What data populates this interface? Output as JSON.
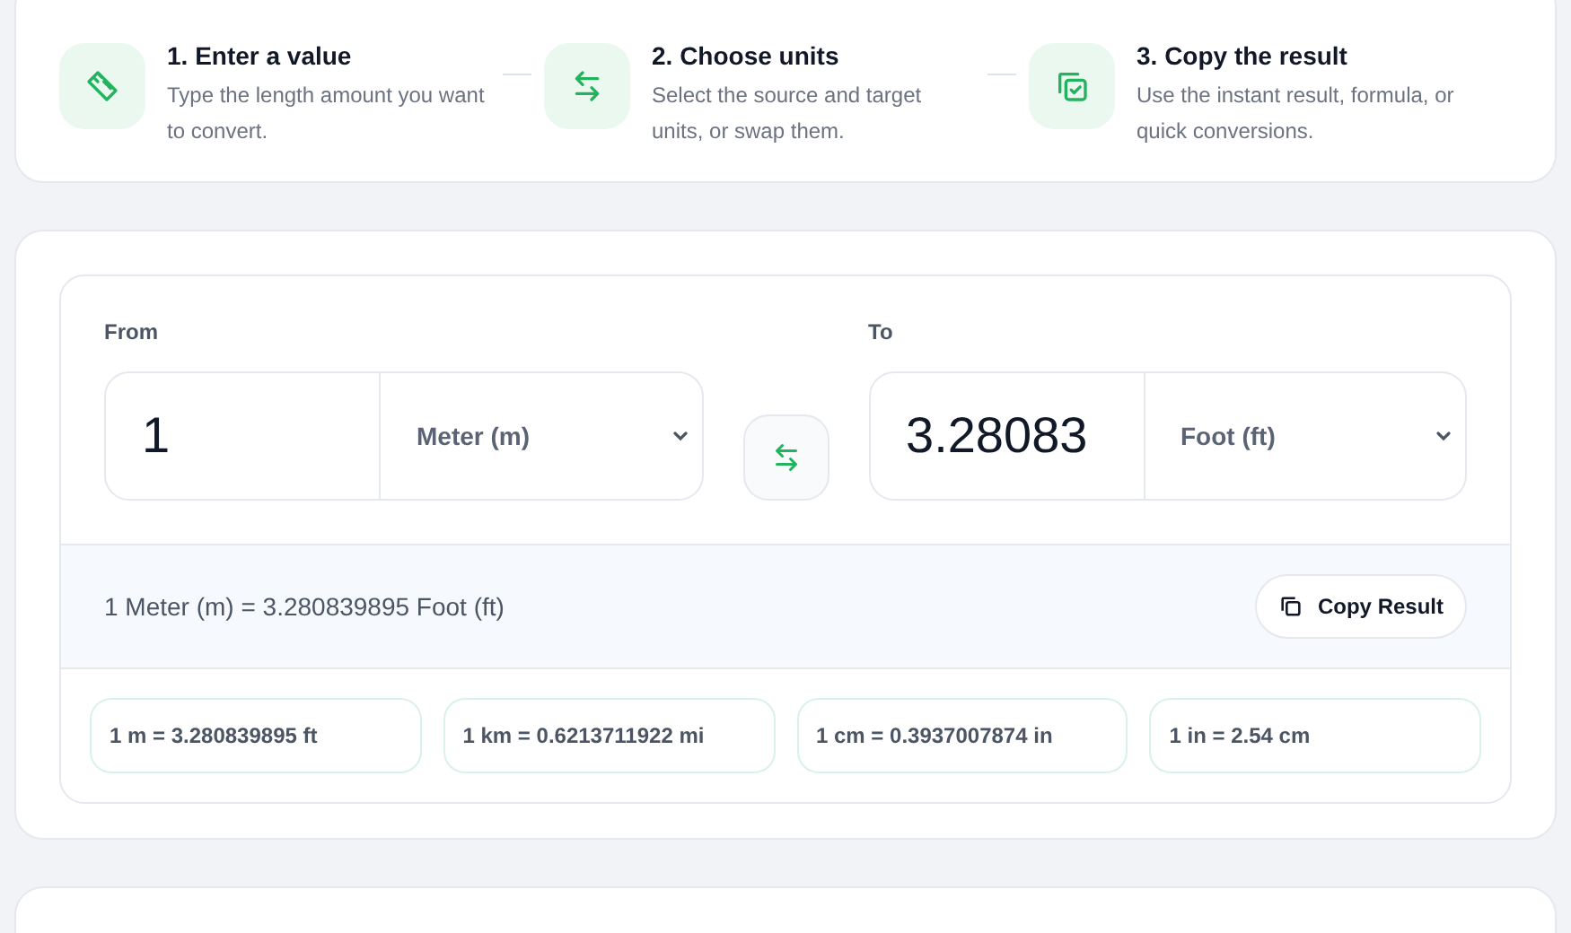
{
  "steps": [
    {
      "kind": "ruler",
      "title": "1. Enter a value",
      "text": "Type the length amount you want to convert."
    },
    {
      "kind": "swap",
      "title": "2. Choose units",
      "text": "Select the source and target units, or swap them."
    },
    {
      "kind": "copy",
      "title": "3. Copy the result",
      "text": "Use the instant result, formula, or quick conversions."
    }
  ],
  "converter": {
    "from": {
      "label": "From",
      "value": "1",
      "unit": "Meter (m)"
    },
    "to": {
      "label": "To",
      "value": "3.28083",
      "unit": "Foot (ft)"
    },
    "formula": "1 Meter (m) = 3.280839895 Foot (ft)",
    "copy_button": "Copy Result",
    "quick": [
      "1 m = 3.280839895 ft",
      "1 km = 0.6213711922 mi",
      "1 cm = 0.3937007874 in",
      "1 in = 2.54 cm"
    ]
  }
}
